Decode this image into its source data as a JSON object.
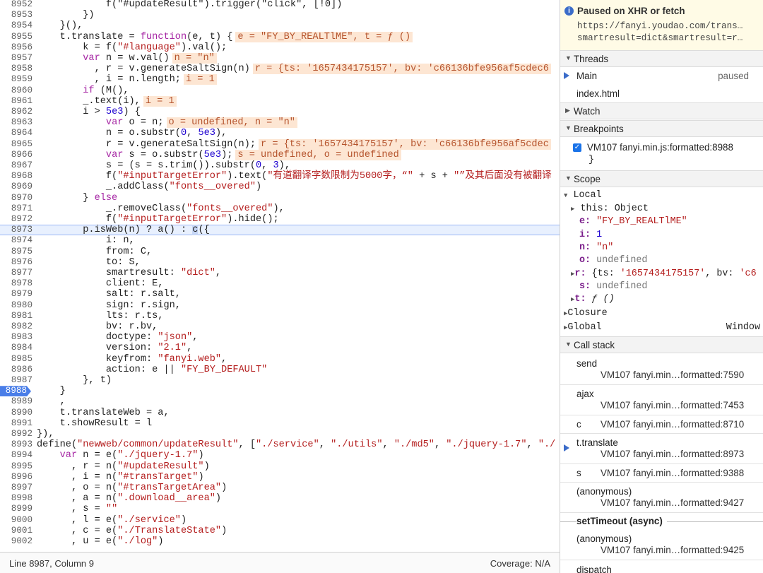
{
  "editor": {
    "lines": [
      {
        "n": "8952",
        "h": "            f(\"#updateResult\").trigger(\"click\", [!0])"
      },
      {
        "n": "8953",
        "h": "        })"
      },
      {
        "n": "8954",
        "h": "    }(),"
      },
      {
        "n": "8955",
        "h": "    t.translate = <span class=\"kw\">function</span>(e, t) {<span class=\"inl\">e = \"FY_BY_REALTlME\", t = ƒ ()</span>"
      },
      {
        "n": "8956",
        "h": "        k = f(<span class=\"str\">\"#language\"</span>).val();"
      },
      {
        "n": "8957",
        "h": "        <span class=\"kw\">var</span> n = w.val()<span class=\"inl\">n = \"n\"</span>"
      },
      {
        "n": "8958",
        "h": "          , r = v.generateSaltSign(n)<span class=\"inl\">r = {ts: '1657434175157', bv: 'c66136bfe956af5cdec6</span>"
      },
      {
        "n": "8959",
        "h": "          , i = n.length;<span class=\"inl\">i = 1</span>"
      },
      {
        "n": "8960",
        "h": "        <span class=\"kw\">if</span> (M(),"
      },
      {
        "n": "8961",
        "h": "        _.text(i),<span class=\"inl\">i = 1</span>"
      },
      {
        "n": "8962",
        "h": "        i > <span class=\"num\">5e3</span>) {"
      },
      {
        "n": "8963",
        "h": "            <span class=\"kw\">var</span> o = n;<span class=\"inl\">o = undefined, n = \"n\"</span>"
      },
      {
        "n": "8964",
        "h": "            n = o.substr(<span class=\"num\">0</span>, <span class=\"num\">5e3</span>),"
      },
      {
        "n": "8965",
        "h": "            r = v.generateSaltSign(n);<span class=\"inl\">r = {ts: '1657434175157', bv: 'c66136bfe956af5cdec</span>"
      },
      {
        "n": "8966",
        "h": "            <span class=\"kw\">var</span> s = o.substr(<span class=\"num\">5e3</span>);<span class=\"inl\">s = undefined, o = undefined</span>"
      },
      {
        "n": "8967",
        "h": "            s = (s = s.trim()).substr(<span class=\"num\">0</span>, <span class=\"num\">3</span>),"
      },
      {
        "n": "8968",
        "h": "            f(<span class=\"str\">\"#inputTargetError\"</span>).text(<span class=\"str\">\"有道翻译字数限制为5000字，“\"</span> + s + <span class=\"str\">\"”及其后面没有被翻译</span>"
      },
      {
        "n": "8969",
        "h": "            _.addClass(<span class=\"str\">\"fonts__overed\"</span>)"
      },
      {
        "n": "8970",
        "h": "        } <span class=\"kw\">else</span>"
      },
      {
        "n": "8971",
        "h": "            _.removeClass(<span class=\"str\">\"fonts__overed\"</span>),"
      },
      {
        "n": "8972",
        "h": "            f(<span class=\"str\">\"#inputTargetError\"</span>).hide();"
      },
      {
        "n": "8973",
        "h": "        p.isWeb(n) ? a() : <span class=\"caret-hl\">c</span>({",
        "current": true
      },
      {
        "n": "8974",
        "h": "            i: n,"
      },
      {
        "n": "8975",
        "h": "            from: C,"
      },
      {
        "n": "8976",
        "h": "            to: S,"
      },
      {
        "n": "8977",
        "h": "            smartresult: <span class=\"str\">\"dict\"</span>,"
      },
      {
        "n": "8978",
        "h": "            client: E,"
      },
      {
        "n": "8979",
        "h": "            salt: r.salt,"
      },
      {
        "n": "8980",
        "h": "            sign: r.sign,"
      },
      {
        "n": "8981",
        "h": "            lts: r.ts,"
      },
      {
        "n": "8982",
        "h": "            bv: r.bv,"
      },
      {
        "n": "8983",
        "h": "            doctype: <span class=\"str\">\"json\"</span>,"
      },
      {
        "n": "8984",
        "h": "            version: <span class=\"str\">\"2.1\"</span>,"
      },
      {
        "n": "8985",
        "h": "            keyfrom: <span class=\"str\">\"fanyi.web\"</span>,"
      },
      {
        "n": "8986",
        "h": "            action: e || <span class=\"str\">\"FY_BY_DEFAULT\"</span>"
      },
      {
        "n": "8987",
        "h": "        }, t)"
      },
      {
        "n": "8988",
        "h": "    }",
        "breakpoint": true
      },
      {
        "n": "8989",
        "h": "    ,"
      },
      {
        "n": "8990",
        "h": "    t.translateWeb = a,"
      },
      {
        "n": "8991",
        "h": "    t.showResult = l"
      },
      {
        "n": "8992",
        "h": "}),"
      },
      {
        "n": "8993",
        "h": "define(<span class=\"str\">\"newweb/common/updateResult\"</span>, [<span class=\"str\">\"./service\"</span>, <span class=\"str\">\"./utils\"</span>, <span class=\"str\">\"./md5\"</span>, <span class=\"str\">\"./jquery-1.7\"</span>, <span class=\"str\">\"./</span>"
      },
      {
        "n": "8994",
        "h": "    <span class=\"kw\">var</span> n = e(<span class=\"str\">\"./jquery-1.7\"</span>)"
      },
      {
        "n": "8995",
        "h": "      , r = n(<span class=\"str\">\"#updateResult\"</span>)"
      },
      {
        "n": "8996",
        "h": "      , i = n(<span class=\"str\">\"#transTarget\"</span>)"
      },
      {
        "n": "8997",
        "h": "      , o = n(<span class=\"str\">\"#transTargetArea\"</span>)"
      },
      {
        "n": "8998",
        "h": "      , a = n(<span class=\"str\">\".download__area\"</span>)"
      },
      {
        "n": "8999",
        "h": "      , s = <span class=\"str\">\"\"</span>"
      },
      {
        "n": "9000",
        "h": "      , l = e(<span class=\"str\">\"./service\"</span>)"
      },
      {
        "n": "9001",
        "h": "      , c = e(<span class=\"str\">\"./TranslateState\"</span>)"
      },
      {
        "n": "9002",
        "h": "      , u = e(<span class=\"str\">\"./log\"</span>)"
      }
    ]
  },
  "status": {
    "position": "Line 8987, Column 9",
    "coverage": "Coverage: N/A"
  },
  "paused": {
    "title": "Paused on XHR or fetch",
    "url_line1": "https://fanyi.youdao.com/trans…",
    "url_line2": "smartresult=dict&smartresult=r…"
  },
  "threads": {
    "header": "Threads",
    "main_label": "Main",
    "main_state": "paused",
    "index": "index.html"
  },
  "watch": {
    "header": "Watch"
  },
  "breakpoints": {
    "header": "Breakpoints",
    "item": "VM107 fanyi.min.js:formatted:8988",
    "code": "}"
  },
  "scope": {
    "header": "Scope",
    "local": "Local",
    "this_key": "this:",
    "this_val": "Object",
    "e_key": "e:",
    "e_val": "\"FY_BY_REALTlME\"",
    "i_key": "i:",
    "i_val": "1",
    "n_key": "n:",
    "n_val": "\"n\"",
    "o_key": "o:",
    "o_val": "undefined",
    "r_key": "r:",
    "r_val1": "{ts: ",
    "r_val2": "'1657434175157'",
    "r_val3": ", bv: ",
    "r_val4": "'c6",
    "s_key": "s:",
    "s_val": "undefined",
    "t_key": "t:",
    "t_val": "ƒ ()",
    "closure": "Closure",
    "global": "Global",
    "global_val": "Window"
  },
  "callstack": {
    "header": "Call stack",
    "frames": [
      {
        "name": "send",
        "loc": "VM107 fanyi.min…formatted:7590"
      },
      {
        "name": "ajax",
        "loc": "VM107 fanyi.min…formatted:7453"
      },
      {
        "name": "c",
        "loc": "VM107 fanyi.min…formatted:8710"
      },
      {
        "name": "t.translate",
        "loc": "VM107 fanyi.min…formatted:8973"
      },
      {
        "name": "s",
        "loc": "VM107 fanyi.min…formatted:9388"
      },
      {
        "name": "(anonymous)",
        "loc": "VM107 fanyi.min…formatted:9427"
      },
      {
        "name": "(anonymous)",
        "loc": "VM107 fanyi.min…formatted:9425"
      },
      {
        "name": "dispatch",
        "loc": ""
      }
    ],
    "async_label": "setTimeout (async)"
  }
}
